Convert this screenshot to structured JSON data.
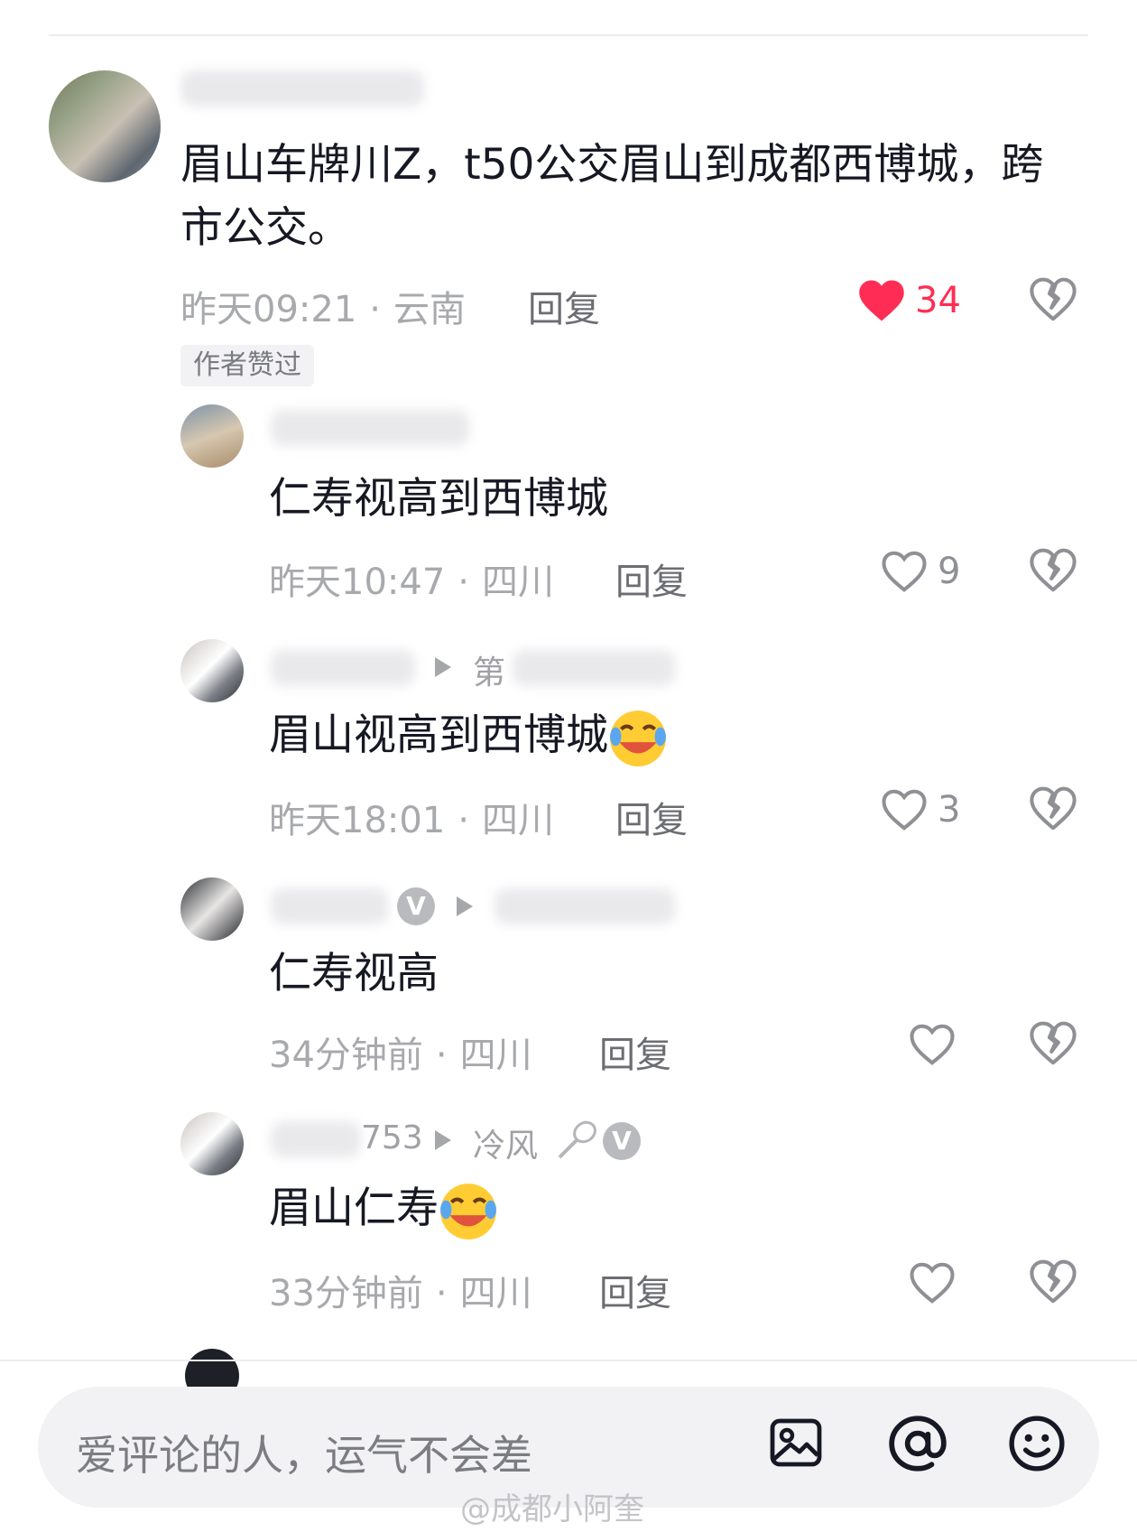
{
  "comments": [
    {
      "text_line1": "眉山车牌川Z，t50公交眉山到成都西博城，跨",
      "text_line2": "市公交。",
      "time": "昨天09:21",
      "region": "云南",
      "reply_label": "回复",
      "likes": "34",
      "liked": true,
      "badge": "作者赞过"
    },
    {
      "text": "仁寿视高到西博城",
      "time": "昨天10:47",
      "region": "四川",
      "reply_label": "回复",
      "likes": "9"
    },
    {
      "username_fragment": "第",
      "text": "眉山视高到西博城",
      "time": "昨天18:01",
      "region": "四川",
      "reply_label": "回复",
      "likes": "3"
    },
    {
      "verified_mark": "V",
      "text": "仁寿视高",
      "time": "34分钟前",
      "region": "四川",
      "reply_label": "回复",
      "likes": ""
    },
    {
      "username_fragment": "753",
      "reply_to": "冷风",
      "verified_mark": "V",
      "text": "眉山仁寿",
      "time": "33分钟前",
      "region": "四川",
      "reply_label": "回复",
      "likes": ""
    }
  ],
  "input_bar": {
    "placeholder": "爱评论的人，运气不会差"
  },
  "watermark": "@成都小阿奎",
  "colors": {
    "accent_like": "#ff2d55",
    "text_primary": "#161823",
    "text_secondary": "#a8a9ad"
  },
  "icons": [
    "heart-filled-icon",
    "heart-outline-icon",
    "broken-heart-icon",
    "image-icon",
    "at-icon",
    "emoji-icon",
    "play-arrow-icon",
    "verified-icon"
  ]
}
